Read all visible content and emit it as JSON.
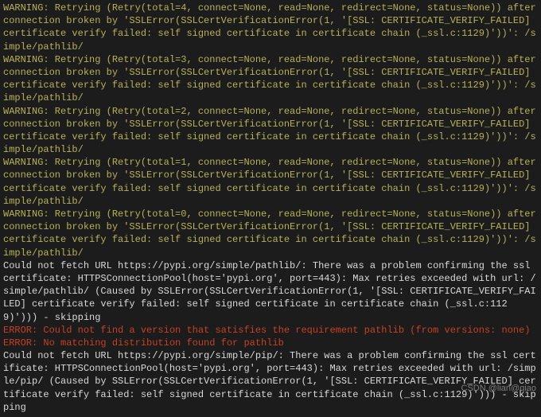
{
  "terminal": {
    "lines": [
      {
        "cls": "warn",
        "text": "WARNING: Retrying (Retry(total=4, connect=None, read=None, redirect=None, status=None)) after connection broken by 'SSLError(SSLCertVerificationError(1, '[SSL: CERTIFICATE_VERIFY_FAILED] certificate verify failed: self signed certificate in certificate chain (_ssl.c:1129)'))': /simple/pathlib/"
      },
      {
        "cls": "warn",
        "text": "WARNING: Retrying (Retry(total=3, connect=None, read=None, redirect=None, status=None)) after connection broken by 'SSLError(SSLCertVerificationError(1, '[SSL: CERTIFICATE_VERIFY_FAILED] certificate verify failed: self signed certificate in certificate chain (_ssl.c:1129)'))': /simple/pathlib/"
      },
      {
        "cls": "warn",
        "text": "WARNING: Retrying (Retry(total=2, connect=None, read=None, redirect=None, status=None)) after connection broken by 'SSLError(SSLCertVerificationError(1, '[SSL: CERTIFICATE_VERIFY_FAILED] certificate verify failed: self signed certificate in certificate chain (_ssl.c:1129)'))': /simple/pathlib/"
      },
      {
        "cls": "warn",
        "text": "WARNING: Retrying (Retry(total=1, connect=None, read=None, redirect=None, status=None)) after connection broken by 'SSLError(SSLCertVerificationError(1, '[SSL: CERTIFICATE_VERIFY_FAILED] certificate verify failed: self signed certificate in certificate chain (_ssl.c:1129)'))': /simple/pathlib/"
      },
      {
        "cls": "warn",
        "text": "WARNING: Retrying (Retry(total=0, connect=None, read=None, redirect=None, status=None)) after connection broken by 'SSLError(SSLCertVerificationError(1, '[SSL: CERTIFICATE_VERIFY_FAILED] certificate verify failed: self signed certificate in certificate chain (_ssl.c:1129)'))': /simple/pathlib/"
      },
      {
        "cls": "normal",
        "text": "Could not fetch URL https://pypi.org/simple/pathlib/: There was a problem confirming the ssl certificate: HTTPSConnectionPool(host='pypi.org', port=443): Max retries exceeded with url: /simple/pathlib/ (Caused by SSLError(SSLCertVerificationError(1, '[SSL: CERTIFICATE_VERIFY_FAILED] certificate verify failed: self signed certificate in certificate chain (_ssl.c:1129)'))) - skipping"
      },
      {
        "cls": "error",
        "text": "ERROR: Could not find a version that satisfies the requirement pathlib (from versions: none)"
      },
      {
        "cls": "error",
        "text": "ERROR: No matching distribution found for pathlib"
      },
      {
        "cls": "normal",
        "text": "Could not fetch URL https://pypi.org/simple/pip/: There was a problem confirming the ssl certificate: HTTPSConnectionPool(host='pypi.org', port=443): Max retries exceeded with url: /simple/pip/ (Caused by SSLError(SSLCertVerificationError(1, '[SSL: CERTIFICATE_VERIFY_FAILED] certificate verify failed: self signed certificate in certificate chain (_ssl.c:1129)'))) - skipping"
      }
    ]
  },
  "watermark": "CSDN @lian@qiao"
}
